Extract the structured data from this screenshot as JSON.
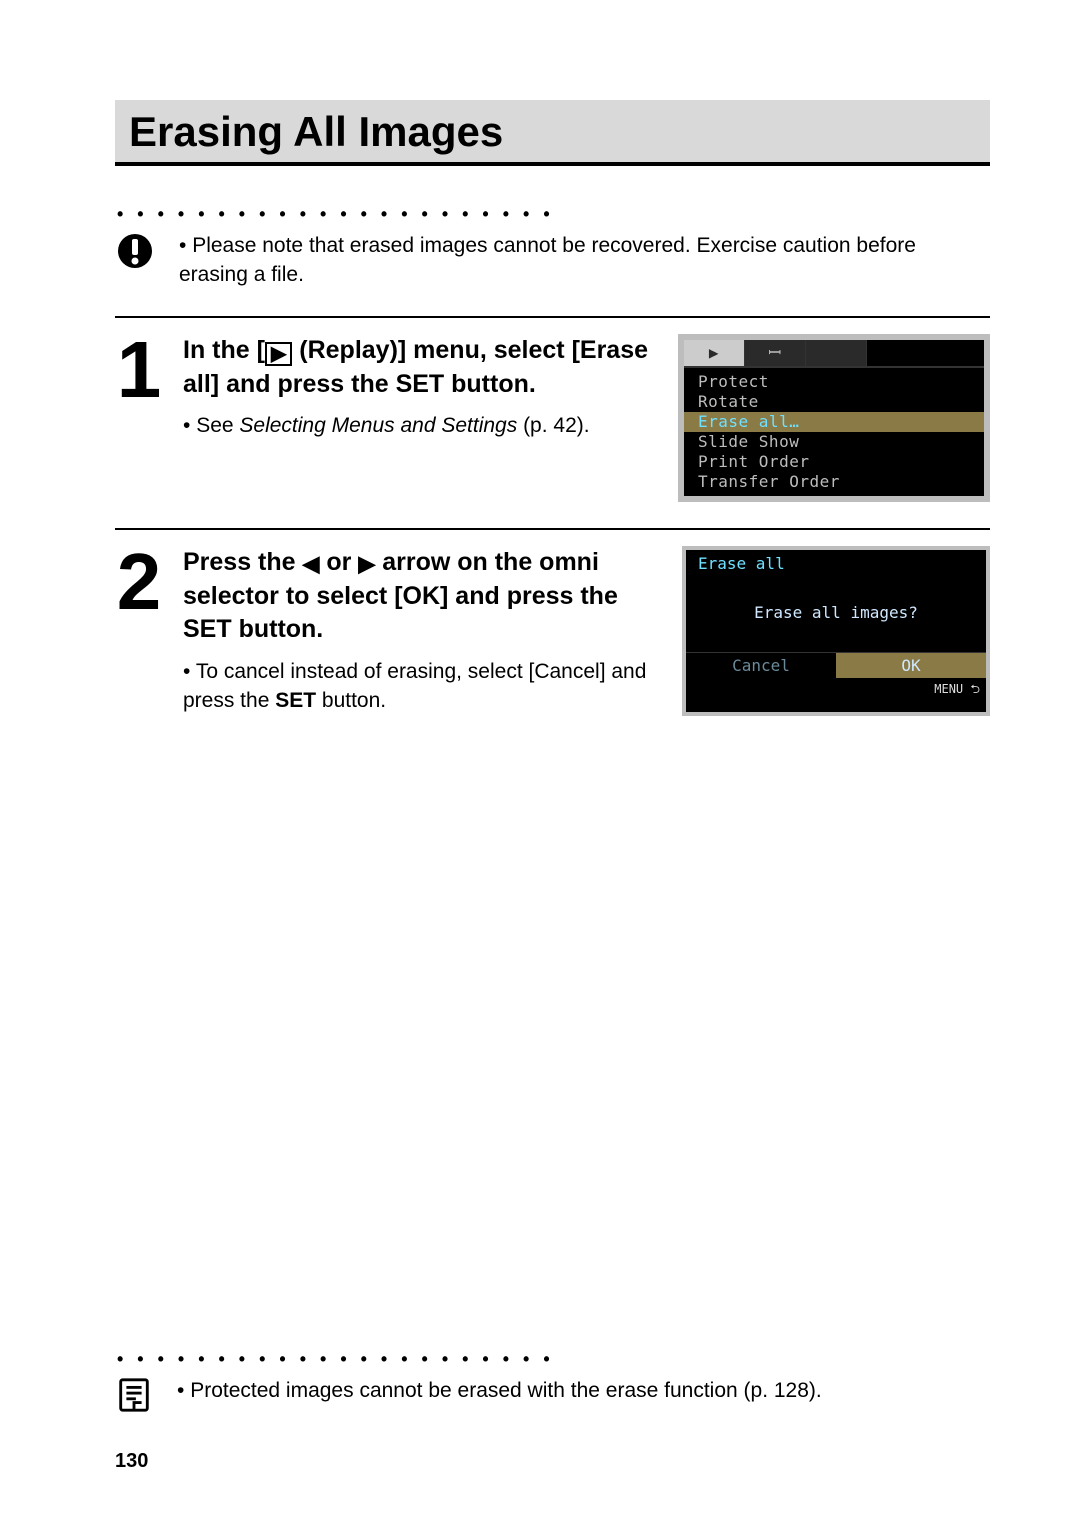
{
  "title": "Erasing All Images",
  "caution_note": "Please note that erased images cannot be recovered. Exercise caution before erasing a file.",
  "step1": {
    "head_pre": "In the [",
    "head_mid": " (Replay)] menu, select [Erase all] and press the ",
    "head_set": "SET",
    "head_post": " button.",
    "bullet_pre": "See ",
    "bullet_it": "Selecting Menus and Settings",
    "bullet_post": " (p. 42)."
  },
  "menu": {
    "items": [
      "Protect",
      "Rotate",
      "Erase all…",
      "Slide Show",
      "Print Order",
      "Transfer Order"
    ],
    "selected_index": 2,
    "tabs": [
      "▶",
      "ꟷ",
      " "
    ]
  },
  "step2": {
    "head_pre": "Press the ",
    "arrow_l": "◀",
    "head_mid1": " or ",
    "arrow_r": "▶",
    "head_mid2": " arrow on the omni selector to select [OK] and press the ",
    "head_set": "SET",
    "head_post": " button.",
    "bullet_pre": "To cancel instead of erasing, select [Cancel] and press the ",
    "bullet_set": "SET",
    "bullet_post": " button."
  },
  "confirm": {
    "title": "Erase all",
    "question": "Erase all images?",
    "cancel": "Cancel",
    "ok": "OK",
    "menu_hint": "MENU ⮌"
  },
  "footer_note": "Protected images cannot be erased with the erase function (p. 128).",
  "page_number": "130"
}
